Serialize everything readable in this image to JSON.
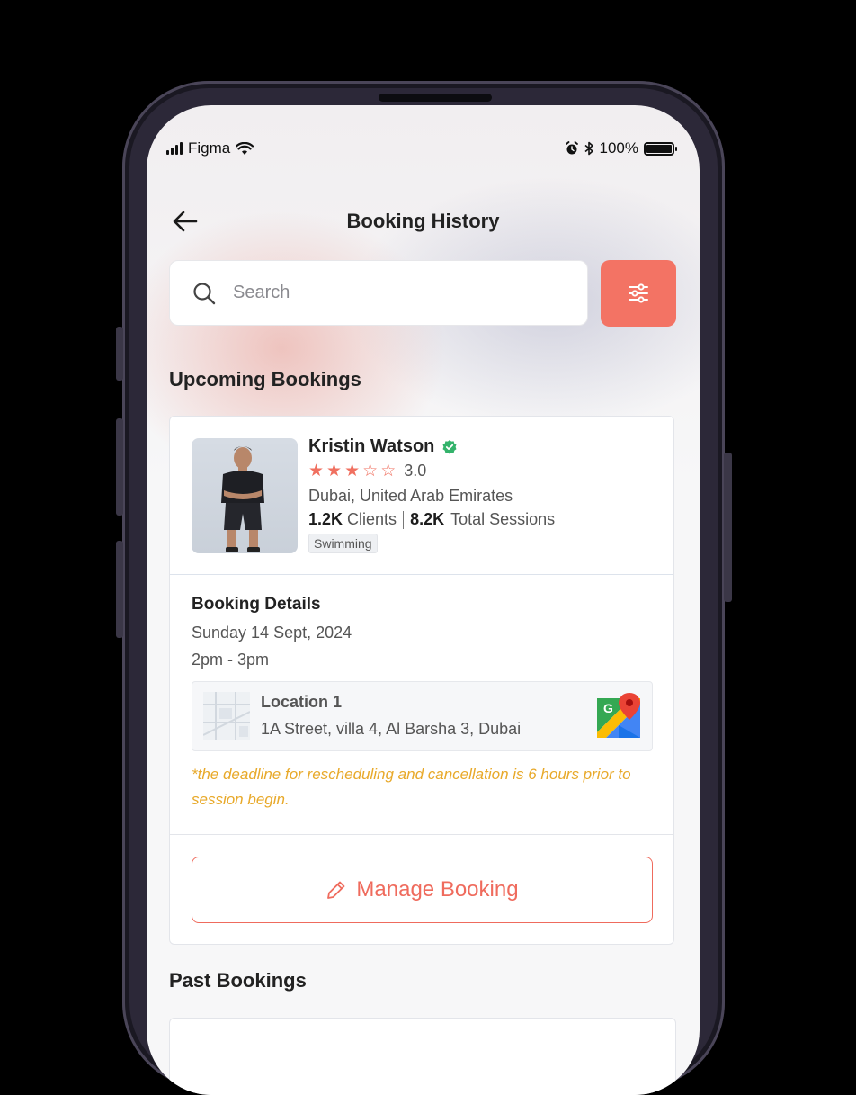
{
  "status_bar": {
    "carrier": "Figma",
    "battery": "100%"
  },
  "header": {
    "title": "Booking History"
  },
  "search": {
    "placeholder": "Search"
  },
  "sections": {
    "upcoming_title": "Upcoming Bookings",
    "past_title": "Past Bookings"
  },
  "booking": {
    "trainer": {
      "name": "Kristin Watson",
      "rating_value": "3.0",
      "rating_stars": 3,
      "rating_max": 5,
      "location": "Dubai, United Arab Emirates",
      "clients_count": "1.2K",
      "clients_label": "Clients",
      "sessions_count": "8.2K",
      "sessions_label": "Total Sessions",
      "tag": "Swimming"
    },
    "details": {
      "title": "Booking Details",
      "date": "Sunday 14 Sept, 2024",
      "time": "2pm - 3pm",
      "location_title": "Location 1",
      "location_address": "1A Street, villa 4, Al Barsha 3, Dubai",
      "note": "*the deadline for rescheduling and cancellation is 6 hours prior to session begin."
    },
    "manage_label": "Manage Booking"
  },
  "colors": {
    "accent": "#f37364",
    "warning_text": "#e8a92a",
    "verified": "#34b36b"
  }
}
